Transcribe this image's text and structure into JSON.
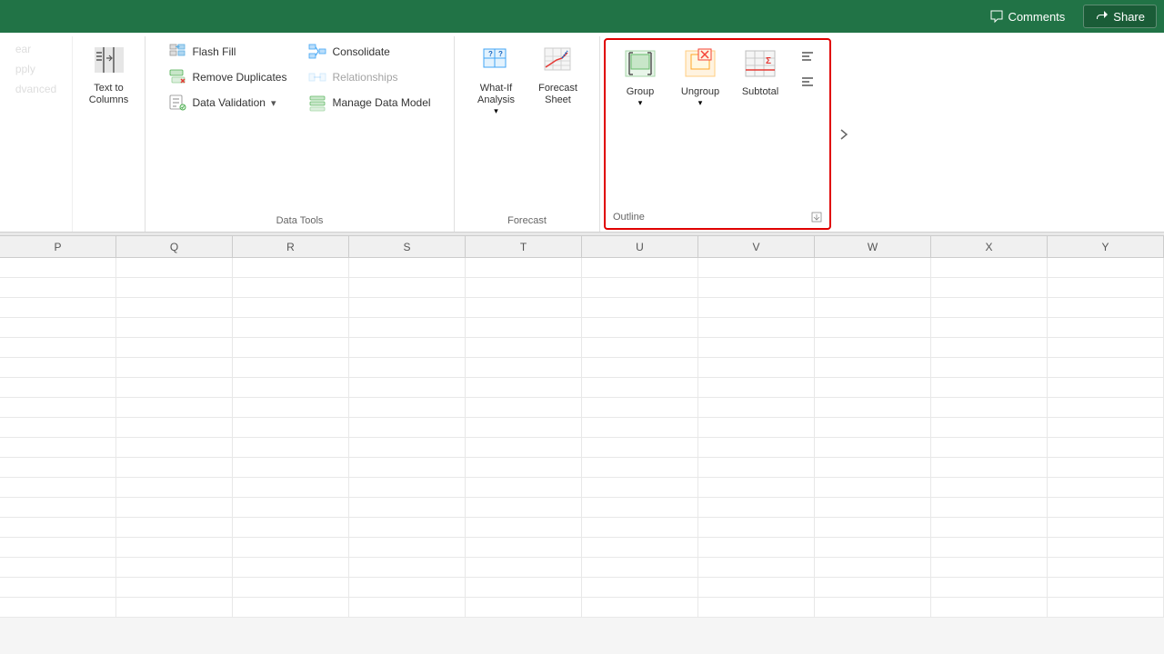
{
  "topbar": {
    "comments_label": "Comments",
    "share_label": "Share"
  },
  "ribbon": {
    "sections": {
      "text_columns": {
        "label": "Text to\nColumns",
        "sublabel": ""
      },
      "data_tools": {
        "label": "Data Tools",
        "flash_fill": "Flash Fill",
        "remove_duplicates": "Remove Duplicates",
        "data_validation": "Data Validation",
        "consolidate": "Consolidate",
        "relationships": "Relationships",
        "manage_data_model": "Manage Data Model"
      },
      "forecast": {
        "label": "Forecast",
        "what_if": "What-If\nAnalysis",
        "forecast_sheet": "Forecast\nSheet"
      },
      "outline": {
        "label": "Outline",
        "group": "Group",
        "ungroup": "Ungroup",
        "subtotal": "Subtotal"
      }
    }
  },
  "spreadsheet": {
    "columns": [
      "P",
      "Q",
      "R",
      "S",
      "T",
      "U",
      "V",
      "W",
      "X",
      "Y"
    ],
    "row_count": 18
  }
}
